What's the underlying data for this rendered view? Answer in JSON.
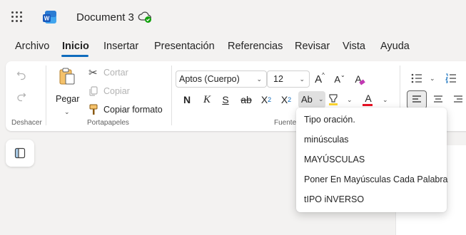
{
  "titlebar": {
    "doc_title": "Document 3",
    "icons": [
      "app-launcher-icon",
      "word-logo-icon",
      "cloud-saved-icon"
    ]
  },
  "tabs": [
    "Archivo",
    "Inicio",
    "Insertar",
    "Presentación",
    "Referencias",
    "Revisar",
    "Vista",
    "Ayuda"
  ],
  "active_tab": "Inicio",
  "ribbon": {
    "undo_group": {
      "label": "Deshacer"
    },
    "clipboard": {
      "label": "Portapapeles",
      "paste": "Pegar",
      "cut": "Cortar",
      "copy": "Copiar",
      "format_painter": "Copiar formato"
    },
    "font": {
      "label": "Fuente",
      "font_name": "Aptos (Cuerpo)",
      "font_size": "12",
      "grow": "A",
      "shrink": "A",
      "clear_format": "A",
      "bold": "N",
      "italic": "K",
      "underline": "S",
      "strike": "ab",
      "sub": "X",
      "sub_index": "2",
      "sup": "X",
      "sup_index": "2",
      "change_case": "Ab",
      "font_color": "A"
    }
  },
  "change_case_menu": {
    "items": [
      "Tipo oración.",
      "minúsculas",
      "MAYÚSCULAS",
      "Poner En Mayúsculas Cada Palabra",
      "tIPO iNVERSO"
    ]
  },
  "colors": {
    "accent": "#0f6cbd",
    "highlight": "#fcd42f",
    "font_color": "#e81123",
    "status_green": "#13a10e"
  }
}
